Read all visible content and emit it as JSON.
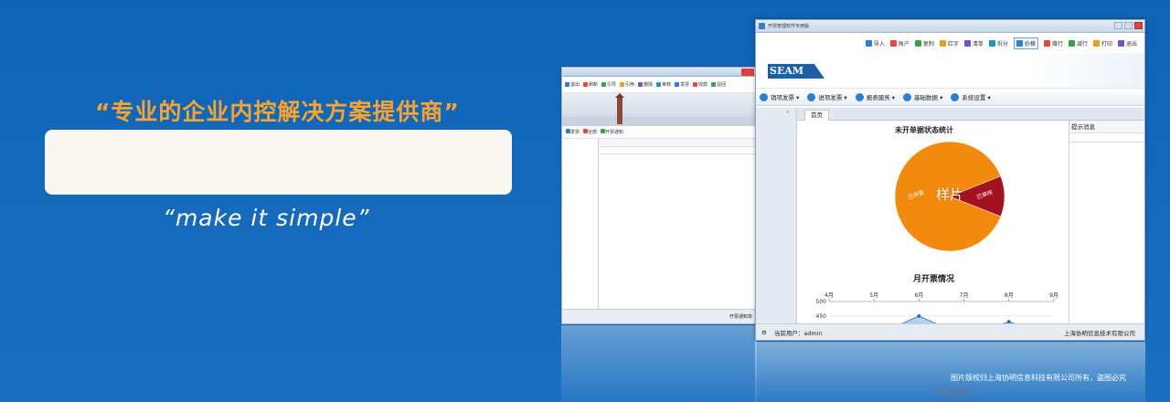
{
  "banner": {
    "headline": "“专业的企业内控解决方案提供商”",
    "slogan": "“make it simple”",
    "copyright": "图片版权归上海协明信息科技有限公司所有，盗图必究"
  },
  "back_window": {
    "toolbar": [
      "退出",
      "刷新",
      "引导",
      "引用",
      "删除",
      "审核",
      "发票",
      "收款",
      "驳回"
    ],
    "toolbar2": [
      "发票",
      "全部",
      "开票通知"
    ],
    "status_right": "开票通知单"
  },
  "front_window": {
    "title": "开票管理软件专用版",
    "toolbar": [
      "导入",
      "账户",
      "复制",
      "红字",
      "清单",
      "拆分",
      "价格",
      "赠行",
      "减行",
      "打印",
      "退出"
    ],
    "logo_text": "SEAM",
    "menu": [
      "销项发票",
      "进项发票",
      "报表服务",
      "基础数据",
      "系统设置"
    ],
    "tab": "首页",
    "side_panel_title": "提示消息",
    "status": {
      "user_label": "当前用户：admin",
      "company": "上海协明信息技术有限公司"
    },
    "watermark": "样片"
  },
  "chart_data": [
    {
      "type": "pie",
      "title": "未开单据状态统计",
      "labels": [
        "已开票",
        "已审核"
      ],
      "values": [
        88,
        12
      ],
      "colors": [
        "#f28a0f",
        "#a3121f"
      ]
    },
    {
      "type": "line",
      "title": "月开票情况",
      "categories": [
        "4月",
        "5月",
        "6月",
        "7月",
        "8月",
        "9月"
      ],
      "y_ticks": [
        500,
        450,
        400
      ],
      "ylim": [
        380,
        500
      ],
      "series": [
        {
          "values": [
            380,
            380,
            450,
            380,
            430,
            380
          ],
          "color": "#2f6fbb"
        }
      ]
    }
  ]
}
